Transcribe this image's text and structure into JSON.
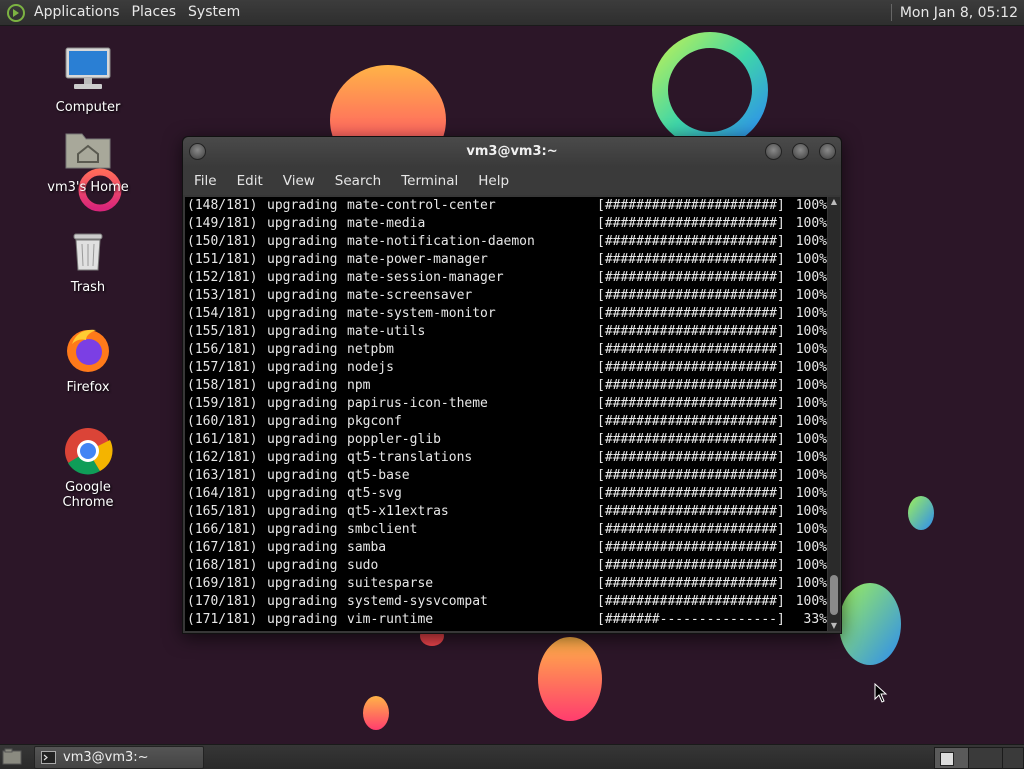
{
  "top_panel": {
    "menus": [
      "Applications",
      "Places",
      "System"
    ],
    "clock": "Mon Jan  8, 05:12"
  },
  "desktop_icons": [
    {
      "label": "Computer"
    },
    {
      "label": "vm3's Home"
    },
    {
      "label": "Trash"
    },
    {
      "label": "Firefox"
    },
    {
      "label": "Google Chrome"
    }
  ],
  "terminal": {
    "title": "vm3@vm3:~",
    "menu": [
      "File",
      "Edit",
      "View",
      "Search",
      "Terminal",
      "Help"
    ],
    "lines": [
      {
        "idx": "(148/181)",
        "action": "upgrading",
        "pkg": "mate-control-center",
        "bar": "[######################]",
        "pct": "100%"
      },
      {
        "idx": "(149/181)",
        "action": "upgrading",
        "pkg": "mate-media",
        "bar": "[######################]",
        "pct": "100%"
      },
      {
        "idx": "(150/181)",
        "action": "upgrading",
        "pkg": "mate-notification-daemon",
        "bar": "[######################]",
        "pct": "100%"
      },
      {
        "idx": "(151/181)",
        "action": "upgrading",
        "pkg": "mate-power-manager",
        "bar": "[######################]",
        "pct": "100%"
      },
      {
        "idx": "(152/181)",
        "action": "upgrading",
        "pkg": "mate-session-manager",
        "bar": "[######################]",
        "pct": "100%"
      },
      {
        "idx": "(153/181)",
        "action": "upgrading",
        "pkg": "mate-screensaver",
        "bar": "[######################]",
        "pct": "100%"
      },
      {
        "idx": "(154/181)",
        "action": "upgrading",
        "pkg": "mate-system-monitor",
        "bar": "[######################]",
        "pct": "100%"
      },
      {
        "idx": "(155/181)",
        "action": "upgrading",
        "pkg": "mate-utils",
        "bar": "[######################]",
        "pct": "100%"
      },
      {
        "idx": "(156/181)",
        "action": "upgrading",
        "pkg": "netpbm",
        "bar": "[######################]",
        "pct": "100%"
      },
      {
        "idx": "(157/181)",
        "action": "upgrading",
        "pkg": "nodejs",
        "bar": "[######################]",
        "pct": "100%"
      },
      {
        "idx": "(158/181)",
        "action": "upgrading",
        "pkg": "npm",
        "bar": "[######################]",
        "pct": "100%"
      },
      {
        "idx": "(159/181)",
        "action": "upgrading",
        "pkg": "papirus-icon-theme",
        "bar": "[######################]",
        "pct": "100%"
      },
      {
        "idx": "(160/181)",
        "action": "upgrading",
        "pkg": "pkgconf",
        "bar": "[######################]",
        "pct": "100%"
      },
      {
        "idx": "(161/181)",
        "action": "upgrading",
        "pkg": "poppler-glib",
        "bar": "[######################]",
        "pct": "100%"
      },
      {
        "idx": "(162/181)",
        "action": "upgrading",
        "pkg": "qt5-translations",
        "bar": "[######################]",
        "pct": "100%"
      },
      {
        "idx": "(163/181)",
        "action": "upgrading",
        "pkg": "qt5-base",
        "bar": "[######################]",
        "pct": "100%"
      },
      {
        "idx": "(164/181)",
        "action": "upgrading",
        "pkg": "qt5-svg",
        "bar": "[######################]",
        "pct": "100%"
      },
      {
        "idx": "(165/181)",
        "action": "upgrading",
        "pkg": "qt5-x11extras",
        "bar": "[######################]",
        "pct": "100%"
      },
      {
        "idx": "(166/181)",
        "action": "upgrading",
        "pkg": "smbclient",
        "bar": "[######################]",
        "pct": "100%"
      },
      {
        "idx": "(167/181)",
        "action": "upgrading",
        "pkg": "samba",
        "bar": "[######################]",
        "pct": "100%"
      },
      {
        "idx": "(168/181)",
        "action": "upgrading",
        "pkg": "sudo",
        "bar": "[######################]",
        "pct": "100%"
      },
      {
        "idx": "(169/181)",
        "action": "upgrading",
        "pkg": "suitesparse",
        "bar": "[######################]",
        "pct": "100%"
      },
      {
        "idx": "(170/181)",
        "action": "upgrading",
        "pkg": "systemd-sysvcompat",
        "bar": "[######################]",
        "pct": "100%"
      },
      {
        "idx": "(171/181)",
        "action": "upgrading",
        "pkg": "vim-runtime",
        "bar": "[#######---------------]",
        "pct": "33%"
      }
    ]
  },
  "taskbar": {
    "window_button": "vm3@vm3:~"
  }
}
